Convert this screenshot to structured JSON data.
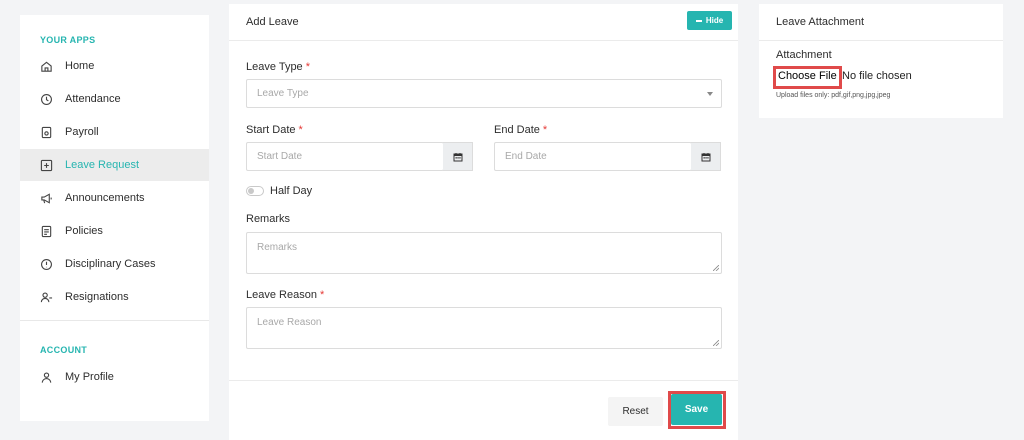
{
  "sidebar": {
    "apps_heading": "YOUR APPS",
    "items": [
      {
        "label": "Home",
        "icon": "home-icon"
      },
      {
        "label": "Attendance",
        "icon": "clock-icon"
      },
      {
        "label": "Payroll",
        "icon": "payroll-icon"
      },
      {
        "label": "Leave Request",
        "icon": "plus-square-icon",
        "active": true
      },
      {
        "label": "Announcements",
        "icon": "megaphone-icon"
      },
      {
        "label": "Policies",
        "icon": "document-icon"
      },
      {
        "label": "Disciplinary Cases",
        "icon": "alert-circle-icon"
      },
      {
        "label": "Resignations",
        "icon": "user-minus-icon"
      }
    ],
    "account_heading": "ACCOUNT",
    "account_items": [
      {
        "label": "My Profile",
        "icon": "user-icon"
      }
    ]
  },
  "form": {
    "title": "Add Leave",
    "hide_label": "Hide",
    "leave_type": {
      "label": "Leave Type",
      "required": "*",
      "placeholder": "Leave Type"
    },
    "start_date": {
      "label": "Start Date",
      "required": "*",
      "placeholder": "Start Date"
    },
    "end_date": {
      "label": "End Date",
      "required": "*",
      "placeholder": "End Date"
    },
    "half_day_label": "Half Day",
    "remarks": {
      "label": "Remarks",
      "placeholder": "Remarks"
    },
    "leave_reason": {
      "label": "Leave Reason",
      "required": "*",
      "placeholder": "Leave Reason"
    },
    "reset_label": "Reset",
    "save_label": "Save"
  },
  "attachment": {
    "title": "Leave Attachment",
    "field_label": "Attachment",
    "choose_label": "Choose File",
    "no_file_text": "No file chosen",
    "hint": "Upload files only: pdf,gif,png,jpg,jpeg"
  },
  "colors": {
    "accent": "#26b5b0",
    "highlight": "#e04a4a",
    "required": "#e53935"
  }
}
